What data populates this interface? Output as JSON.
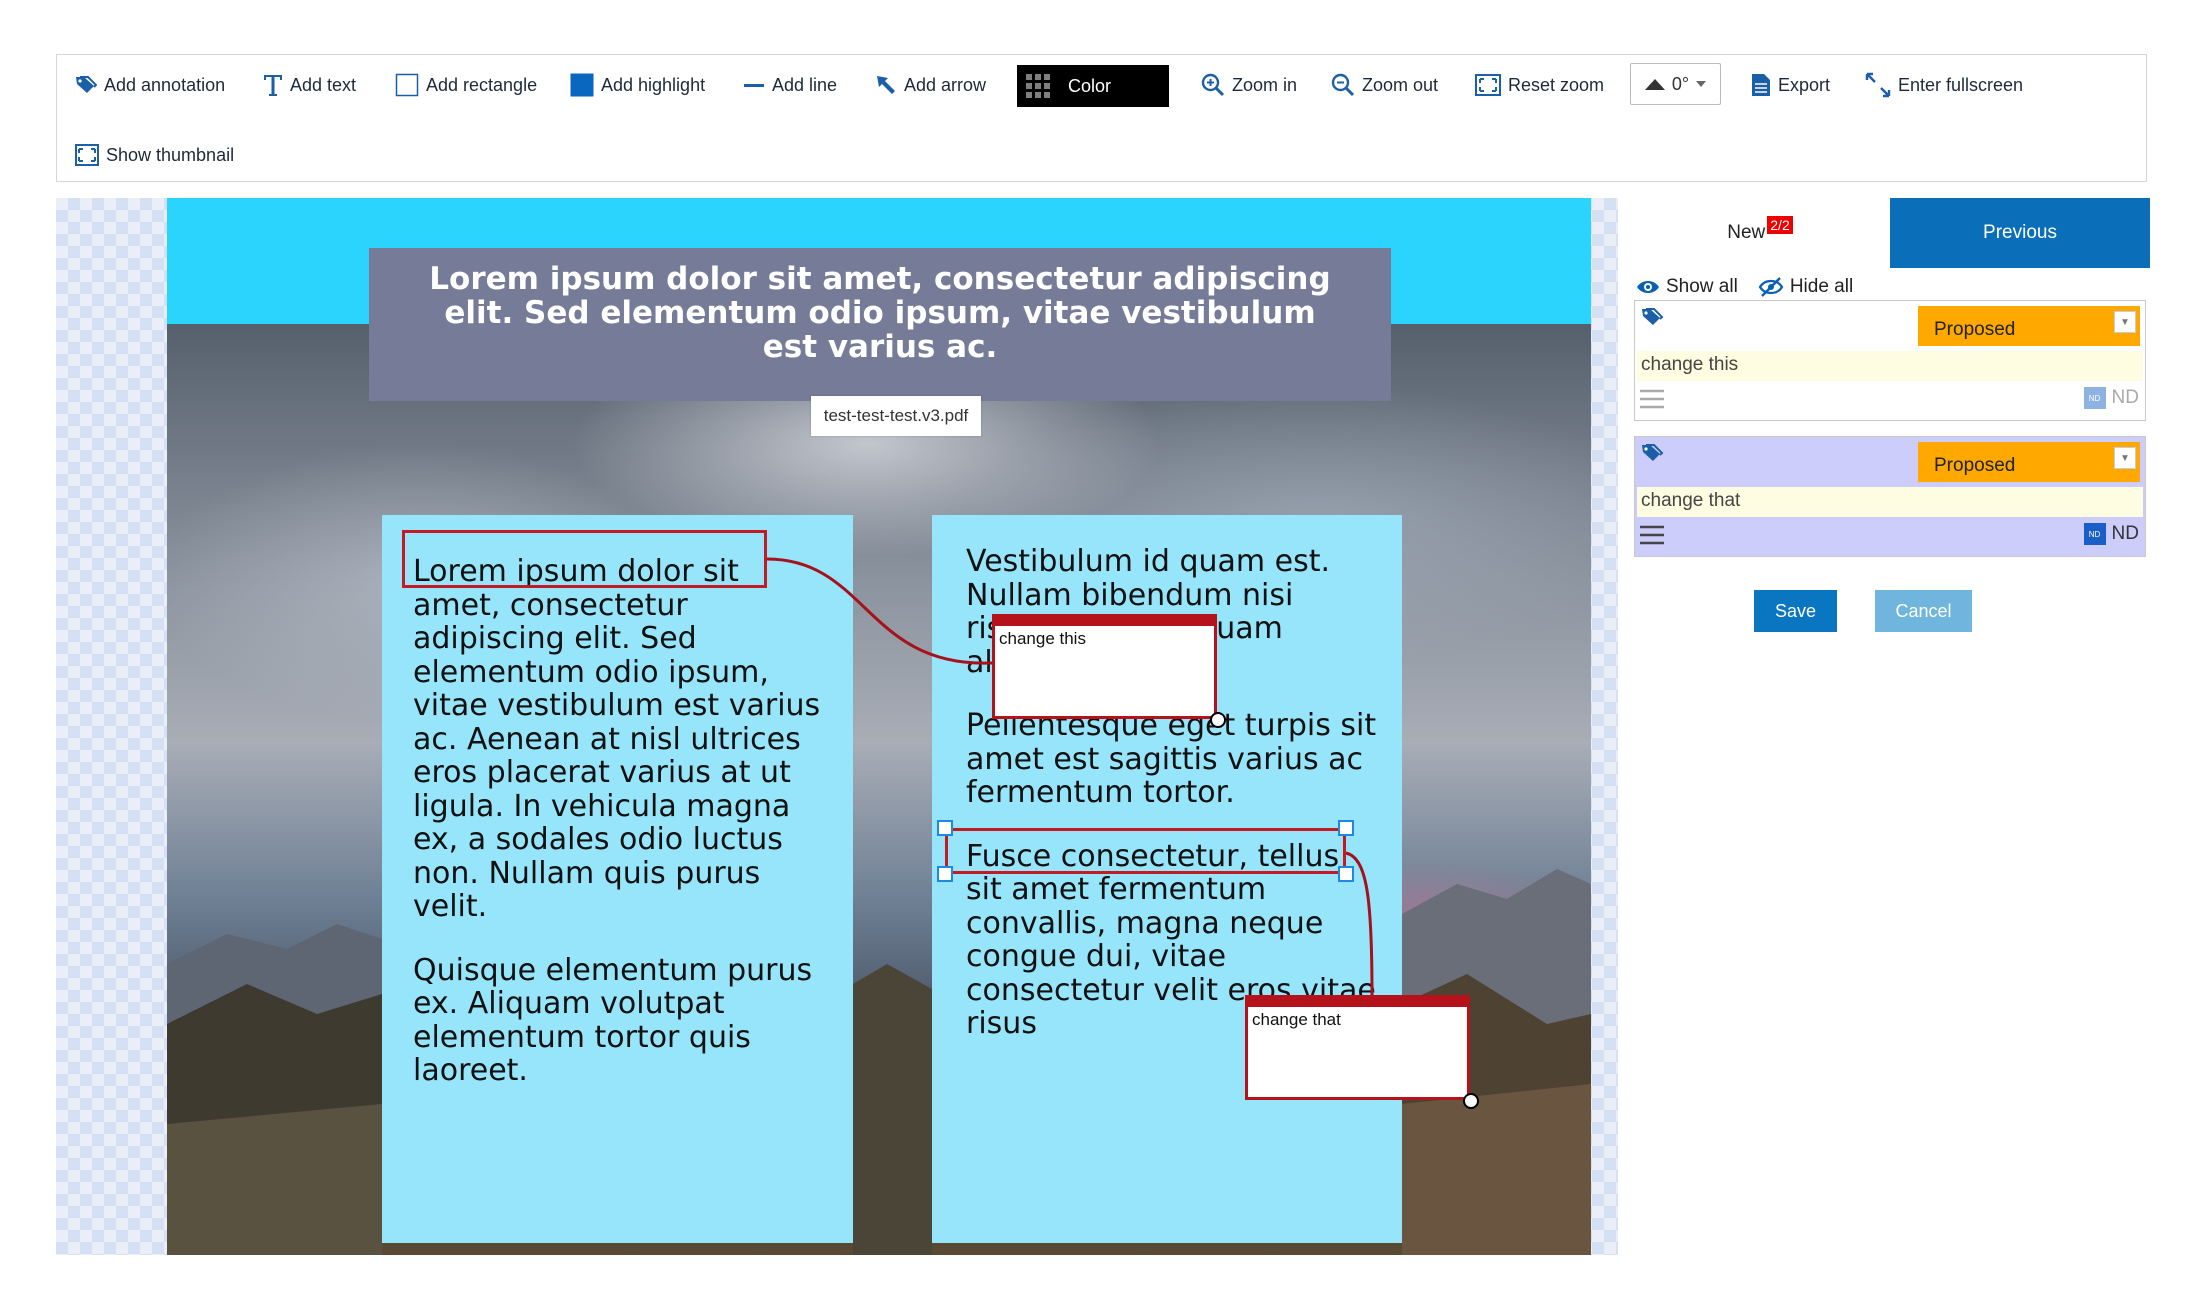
{
  "toolbar": {
    "add_annotation": "Add annotation",
    "add_text": "Add text",
    "add_rectangle": "Add rectangle",
    "add_highlight": "Add highlight",
    "add_line": "Add line",
    "add_arrow": "Add arrow",
    "color": "Color",
    "zoom_in": "Zoom in",
    "zoom_out": "Zoom out",
    "reset_zoom": "Reset zoom",
    "rotation": "0°",
    "export": "Export",
    "enter_fullscreen": "Enter fullscreen",
    "show_thumbnail": "Show thumbnail"
  },
  "document": {
    "filename": "test-test-test.v3.pdf",
    "title": "Lorem ipsum dolor sit amet, consectetur adipiscing elit. Sed elementum odio ipsum, vitae vestibulum est varius ac.",
    "col1": {
      "p1_highlight": "Lorem ipsum dolor sit",
      "p1_rest": "amet, consectetur adipiscing elit. Sed elementum odio ipsum, vitae vestibulum est varius ac. Aenean at nisl ultrices eros placerat varius at ut ligula. In vehicula magna ex, a sodales odio luctus non. Nullam quis purus velit.",
      "p2": "Quisque elementum purus ex. Aliquam volutpat elementum tortor quis laoreet."
    },
    "col2": {
      "p1": "Vestibulum id quam est. Nullam bibendum nisi risus, a rutrum quam aliquam quis.",
      "p2": "Pellentesque eget turpis sit amet est sagittis varius ac fermentum tortor.",
      "p3_highlight": "Fusce consectetur, tellus",
      "p3_rest": "sit amet fermentum convallis, magna neque congue dui, vitae consectetur velit eros vitae risus"
    },
    "notes": [
      {
        "text": "change this"
      },
      {
        "text": "change that"
      }
    ]
  },
  "panel": {
    "tab_new": "New",
    "tab_new_badge": "2/2",
    "tab_previous": "Previous",
    "show_all": "Show all",
    "hide_all": "Hide all",
    "annotations": [
      {
        "status": "Proposed",
        "comment": "change this",
        "author": "ND",
        "color": "#ffffff"
      },
      {
        "status": "Proposed",
        "comment": "change that",
        "author": "ND",
        "color": "#cccdfb"
      }
    ],
    "save": "Save",
    "cancel": "Cancel"
  },
  "colors": {
    "accent": "#0a6fb8",
    "status_proposed": "#fea800",
    "annotation_red": "#c21b24",
    "page_background": "#2ad4fc",
    "column_background": "#96e5fb"
  }
}
